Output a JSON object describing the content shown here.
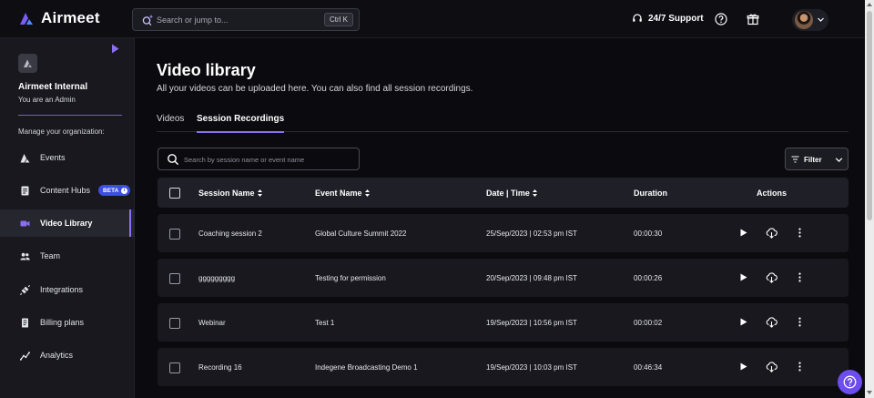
{
  "app": {
    "name": "Airmeet"
  },
  "topbar": {
    "search_placeholder": "Search or jump to...",
    "search_shortcut": "Ctrl K",
    "support_label": "24/7 Support"
  },
  "sidebar": {
    "org_name": "Airmeet Internal",
    "org_role": "You are an Admin",
    "manage_label": "Manage your organization:",
    "items": [
      {
        "label": "Events",
        "icon": "events-icon"
      },
      {
        "label": "Content Hubs",
        "icon": "content-hubs-icon",
        "badge": "BETA"
      },
      {
        "label": "Video Library",
        "icon": "video-icon",
        "active": true
      },
      {
        "label": "Team",
        "icon": "team-icon"
      },
      {
        "label": "Integrations",
        "icon": "integrations-icon"
      },
      {
        "label": "Billing plans",
        "icon": "billing-icon"
      },
      {
        "label": "Analytics",
        "icon": "analytics-icon"
      }
    ]
  },
  "main": {
    "title": "Video library",
    "subtitle": "All your videos can be uploaded here. You can also find all session recordings.",
    "tabs": [
      {
        "label": "Videos",
        "active": false
      },
      {
        "label": "Session Recordings",
        "active": true
      }
    ],
    "search_placeholder": "Search by session name or event name",
    "filter_label": "Filter",
    "columns": {
      "session": "Session Name",
      "event": "Event Name",
      "date": "Date | Time",
      "duration": "Duration",
      "actions": "Actions"
    },
    "rows": [
      {
        "session": "Coaching session 2",
        "event": "Global Culture Summit 2022",
        "date": "25/Sep/2023 | 02:53 pm IST",
        "duration": "00:00:30"
      },
      {
        "session": "ggggggggg",
        "event": "Testing for permission",
        "date": "20/Sep/2023 | 09:48 pm IST",
        "duration": "00:00:26"
      },
      {
        "session": "Webinar",
        "event": "Test 1",
        "date": "19/Sep/2023 | 10:56 pm IST",
        "duration": "00:00:02"
      },
      {
        "session": "Recording 16",
        "event": "Indegene Broadcasting Demo 1",
        "date": "19/Sep/2023 | 10:03 pm IST",
        "duration": "00:46:34"
      }
    ]
  },
  "colors": {
    "accent": "#8b6ff0",
    "background": "#0b0b0f",
    "sidebar": "#18181e",
    "beta_badge": "#3b4fe0",
    "help_fab": "#6d4cf0"
  }
}
